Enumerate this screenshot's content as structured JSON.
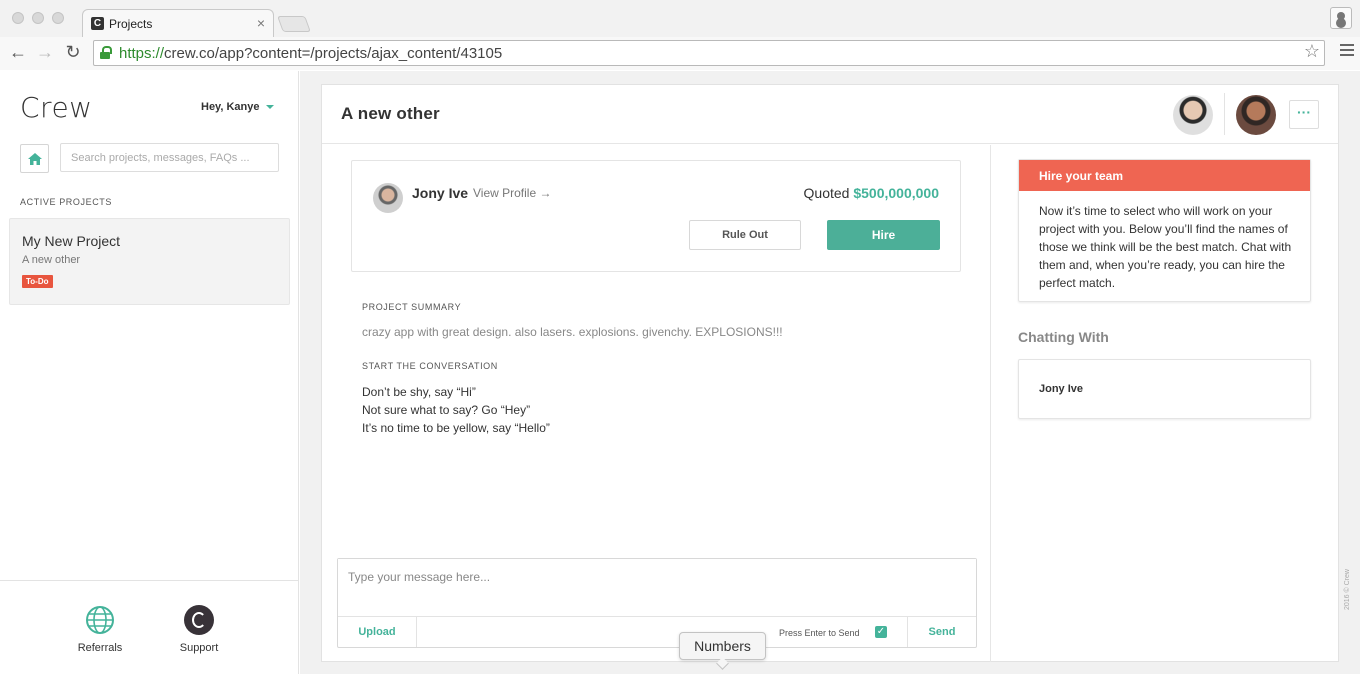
{
  "browser": {
    "tab_title": "Projects",
    "tab_favicon": "C",
    "url_scheme": "https://",
    "url_rest": "crew.co/app?content=/projects/ajax_content/43105"
  },
  "sidebar": {
    "brand": "Crew",
    "greeting": "Hey, Kanye",
    "search_placeholder": "Search projects, messages, FAQs ...",
    "section_label": "ACTIVE PROJECTS",
    "projects": [
      {
        "title": "My New Project",
        "subtitle": "A new other",
        "badge": "To-Do"
      }
    ],
    "footer": {
      "referrals": "Referrals",
      "support": "Support"
    }
  },
  "project": {
    "title": "A new other",
    "more_label": "···",
    "quote": {
      "name": "Jony Ive",
      "view_profile": "View Profile →",
      "quoted_label": "Quoted",
      "amount": "$500,000,000",
      "rule_out": "Rule Out",
      "hire": "Hire"
    },
    "summary_label": "PROJECT SUMMARY",
    "summary": "crazy app with great design. also lasers. explosions. givenchy. EXPLOSIONS!!!",
    "conversation_label": "START THE CONVERSATION",
    "conversation_lines": [
      "Don’t be shy, say “Hi”",
      "Not sure what to say? Go “Hey”",
      "It’s no time to be yellow, say “Hello”"
    ],
    "message": {
      "placeholder": "Type your message here...",
      "upload": "Upload",
      "enter_label": "Press Enter to Send",
      "send": "Send"
    }
  },
  "right_panel": {
    "hire_title": "Hire your team",
    "hire_body": "Now it’s time to select who will work on your project with you. Below you’ll find the names of those we think will be the best match. Chat with them and, when you’re ready, you can hire the perfect match.",
    "chatting_title": "Chatting With",
    "chatting_name": "Jony Ive"
  },
  "copyright": "2016 © Crew",
  "tooltip": "Numbers",
  "colors": {
    "accent": "#44b39a",
    "alert": "#ef6552",
    "badge": "#e8553e"
  }
}
